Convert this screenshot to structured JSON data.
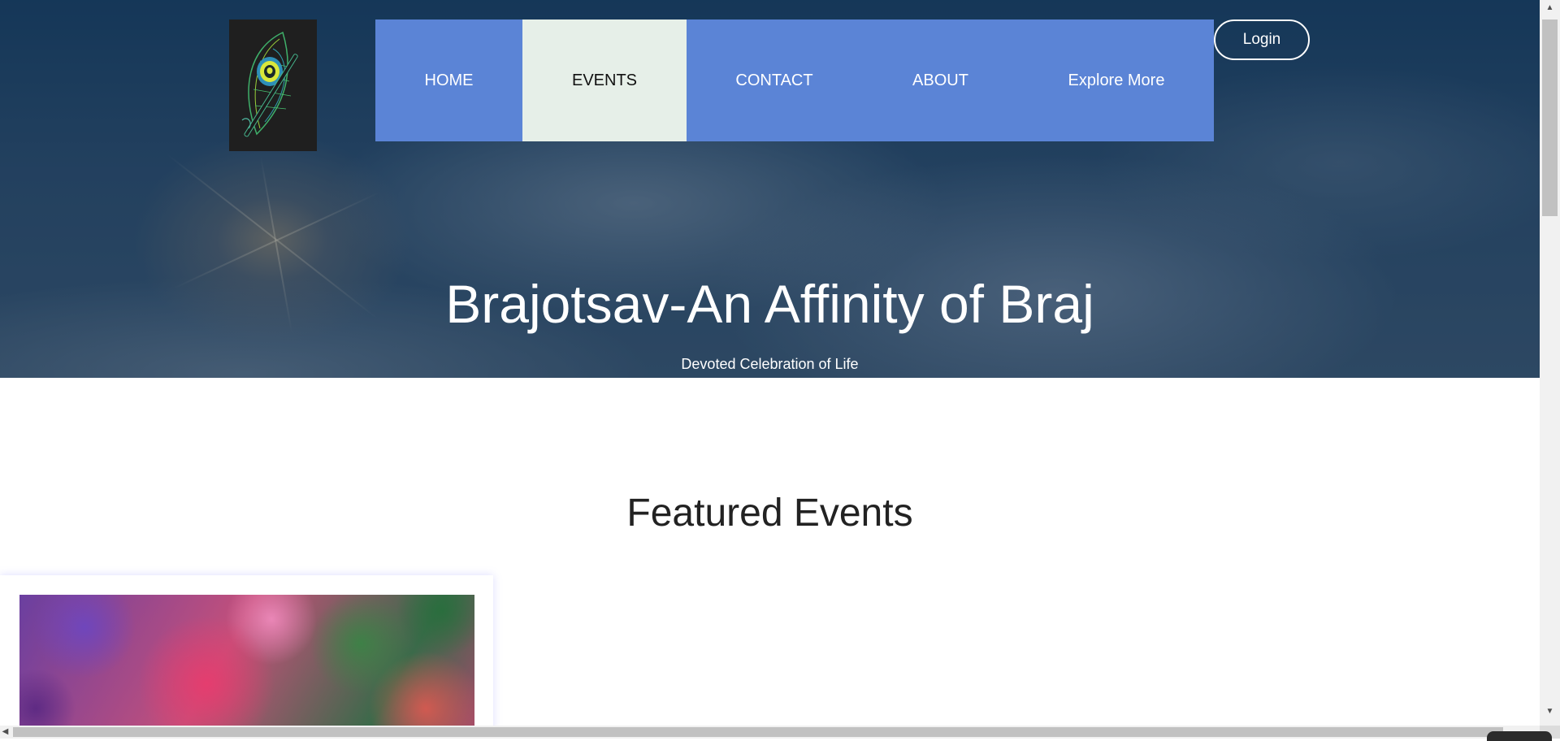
{
  "nav": {
    "items": [
      {
        "label": "HOME"
      },
      {
        "label": "EVENTS"
      },
      {
        "label": "CONTACT"
      },
      {
        "label": "ABOUT"
      },
      {
        "label": "Explore More"
      }
    ],
    "active": "EVENTS",
    "login_label": "Login"
  },
  "hero": {
    "title": "Brajotsav-An Affinity of Braj",
    "subtitle": "Devoted Celebration of Life"
  },
  "featured": {
    "heading": "Featured Events"
  },
  "colors": {
    "nav_bg": "#5b84d6",
    "nav_active_bg": "#e6efe8",
    "hero_overlay": "#1f3d5c"
  },
  "icons": {
    "logo": "peacock-feather-flute-logo",
    "scroll_up": "arrow-up-icon",
    "scroll_down": "arrow-down-icon",
    "scroll_left": "arrow-left-icon"
  }
}
